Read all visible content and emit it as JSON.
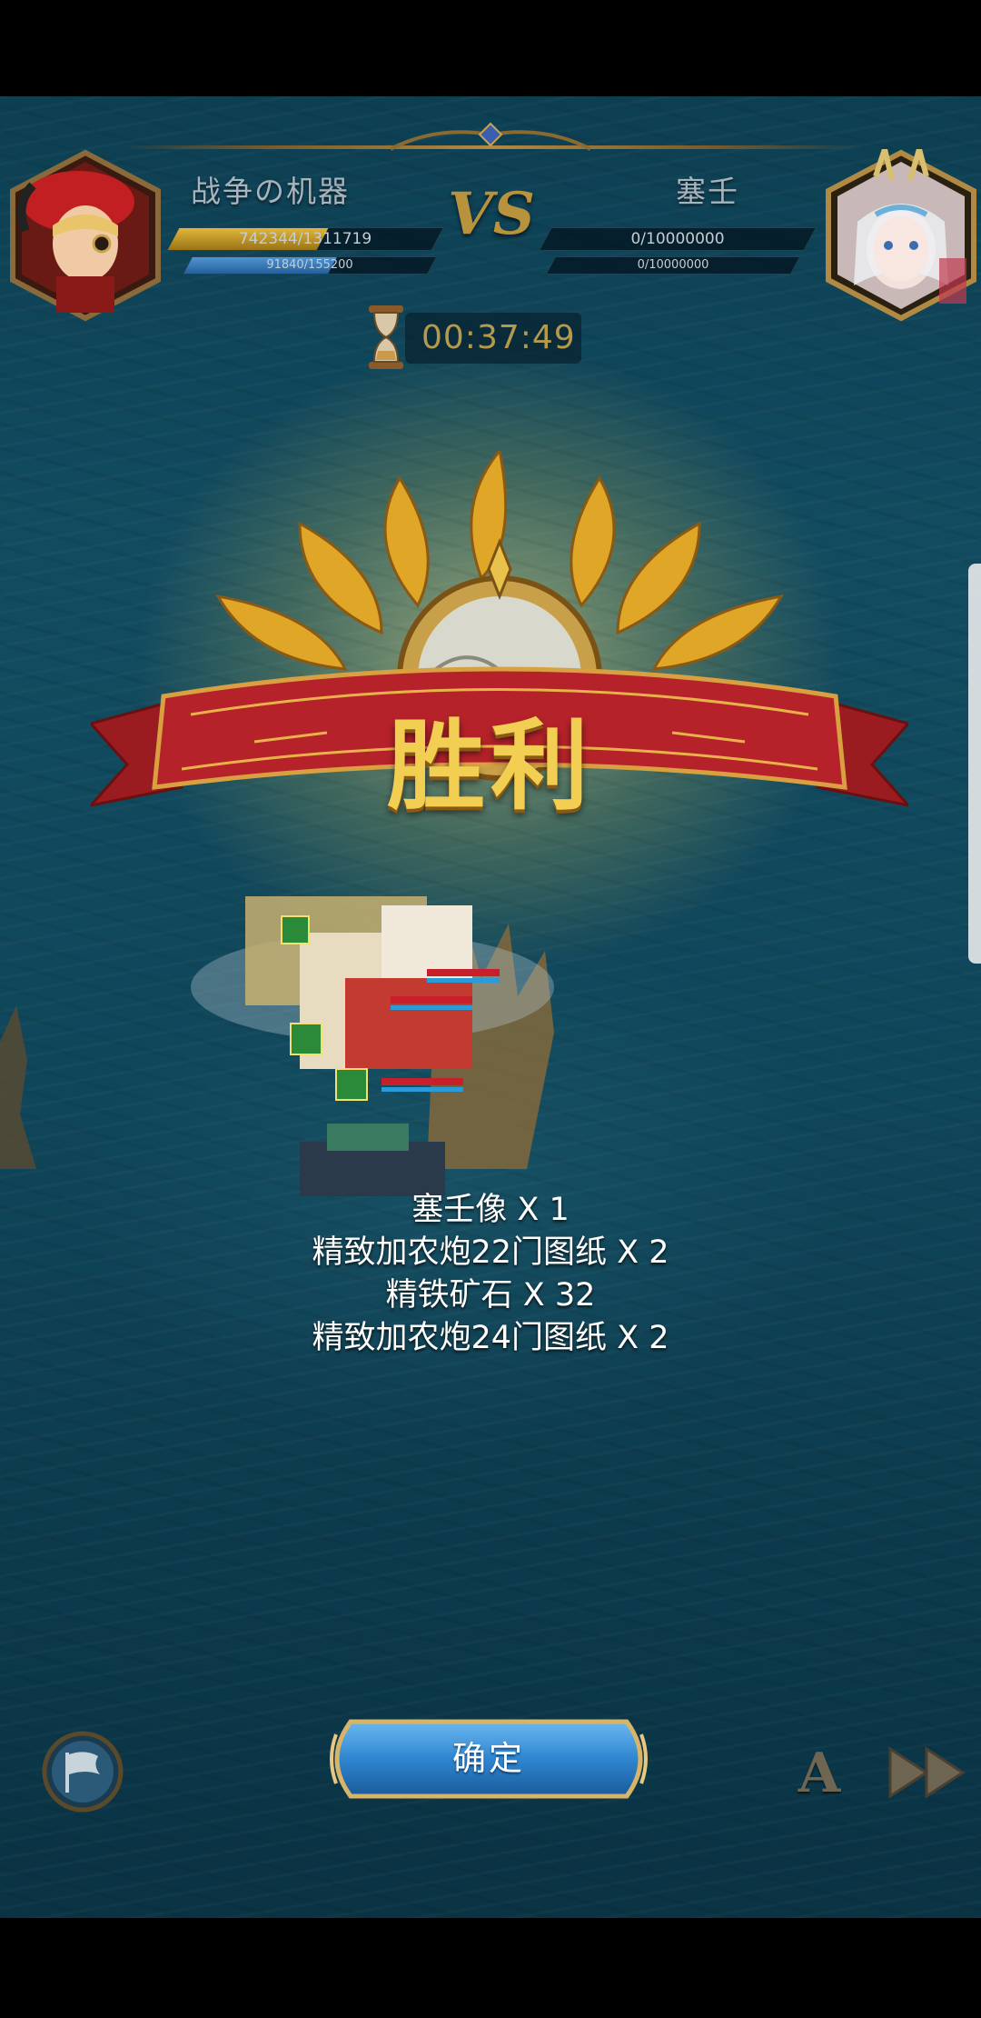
{
  "hud": {
    "player": {
      "name": "战争の机器",
      "hp_text": "742344/1311719",
      "hp_fraction": 0.566,
      "sub_text": "91840/155200",
      "sub_fraction": 0.592
    },
    "vs_label": "VS",
    "enemy": {
      "name": "塞壬",
      "hp_text": "0/10000000",
      "hp_fraction": 0,
      "sub_text": "0/10000000",
      "sub_fraction": 0
    },
    "timer": "00:37:49"
  },
  "result": {
    "title": "胜利"
  },
  "rewards": [
    "塞壬像 X 1",
    "精致加农炮22门图纸 X 2",
    "精铁矿石 X 32",
    "精致加农炮24门图纸 X 2"
  ],
  "controls": {
    "confirm_label": "确定",
    "auto_label": "A"
  },
  "colors": {
    "hp_bar": "#c8a02a",
    "sub_bar": "#3a7ab8",
    "title_gold": "#f2cf52",
    "ribbon_red": "#b5222a",
    "button_blue": "#2f86d0"
  },
  "icons": {
    "flag": "flag-icon",
    "hourglass": "hourglass-icon",
    "speed": "fast-forward-icon"
  }
}
